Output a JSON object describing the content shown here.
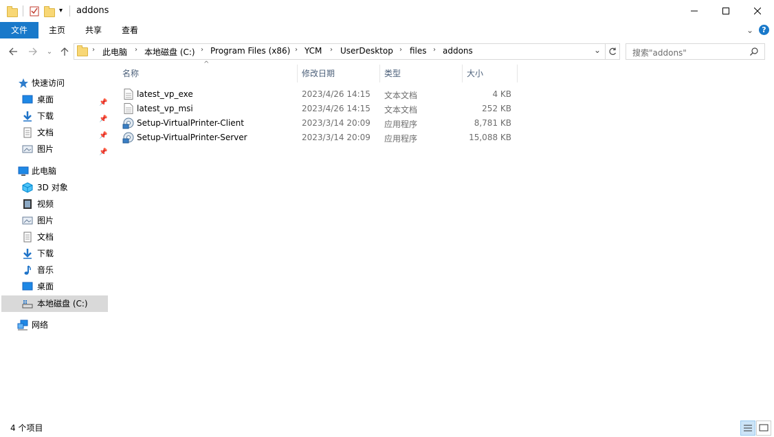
{
  "window": {
    "title": "addons",
    "minimize_icon": "minimize-icon",
    "maximize_icon": "maximize-icon",
    "close_icon": "close-icon"
  },
  "ribbon": {
    "tabs": [
      {
        "label": "文件"
      },
      {
        "label": "主页"
      },
      {
        "label": "共享"
      },
      {
        "label": "查看"
      }
    ]
  },
  "address": {
    "breadcrumbs": [
      "此电脑",
      "本地磁盘 (C:)",
      "Program Files (x86)",
      "YCM",
      "UserDesktop",
      "files",
      "addons"
    ]
  },
  "search": {
    "placeholder": "搜索\"addons\""
  },
  "nav": {
    "quick_access": "快速访问",
    "quick_items": [
      "桌面",
      "下载",
      "文档",
      "图片"
    ],
    "this_pc": "此电脑",
    "pc_items": [
      "3D 对象",
      "视频",
      "图片",
      "文档",
      "下载",
      "音乐",
      "桌面",
      "本地磁盘 (C:)"
    ],
    "network": "网络"
  },
  "columns": {
    "name": "名称",
    "modified": "修改日期",
    "type": "类型",
    "size": "大小"
  },
  "files": [
    {
      "name": "latest_vp_exe",
      "modified": "2023/4/26 14:15",
      "type": "文本文档",
      "size": "4 KB",
      "icon": "text-file-icon"
    },
    {
      "name": "latest_vp_msi",
      "modified": "2023/4/26 14:15",
      "type": "文本文档",
      "size": "252 KB",
      "icon": "text-file-icon"
    },
    {
      "name": "Setup-VirtualPrinter-Client",
      "modified": "2023/3/14 20:09",
      "type": "应用程序",
      "size": "8,781 KB",
      "icon": "installer-icon"
    },
    {
      "name": "Setup-VirtualPrinter-Server",
      "modified": "2023/3/14 20:09",
      "type": "应用程序",
      "size": "15,088 KB",
      "icon": "installer-icon"
    }
  ],
  "status": {
    "item_count": "4 个项目"
  },
  "colors": {
    "accent": "#1979ca",
    "selected_nav": "#d9d9d9"
  }
}
